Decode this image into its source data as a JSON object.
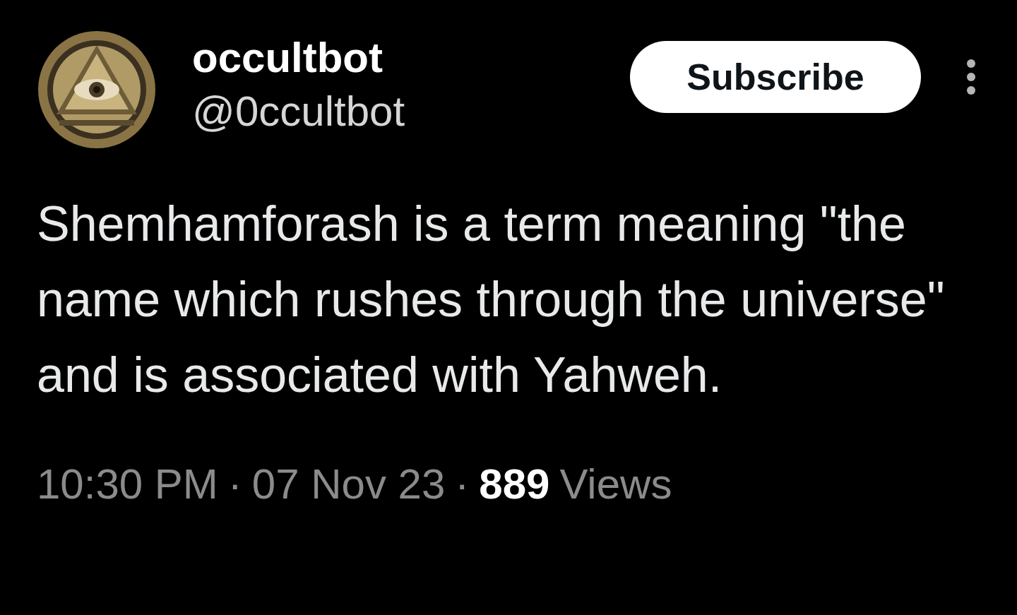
{
  "author": {
    "name": "occultbot",
    "handle": "@0ccultbot"
  },
  "subscribe_button": {
    "label": "Subscribe"
  },
  "post": {
    "text": "Shemhamforash is a term meaning \"the name which rushes through the universe\" and is associated with Yahweh."
  },
  "footer": [
    {
      "kind": "meta",
      "text": "10:30 PM"
    },
    {
      "kind": "separator",
      "text": "·"
    },
    {
      "kind": "meta",
      "text": "07 Nov 23"
    },
    {
      "kind": "separator",
      "text": "·"
    },
    {
      "kind": "count",
      "text": "889"
    },
    {
      "kind": "meta",
      "text": "Views"
    }
  ]
}
